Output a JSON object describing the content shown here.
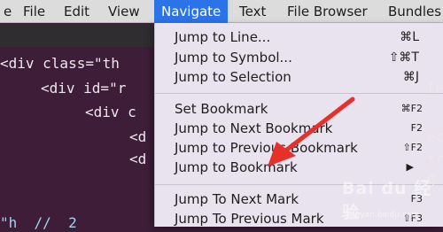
{
  "menubar": {
    "items": [
      "e",
      "File",
      "Edit",
      "View",
      "Navigate",
      "Text",
      "File Browser",
      "Bundles"
    ],
    "active": "Navigate"
  },
  "editor": {
    "lines": [
      "<div class=\"th",
      "<div id=\"r",
      "<div c",
      "<d",
      "<d"
    ],
    "right_fragments": [
      "le",
      "ec",
      "tr",
      "g-"
    ],
    "bottom_fragment": "\"h  //  2"
  },
  "navigate_menu": {
    "items": [
      {
        "label": "Jump to Line...",
        "shortcut": "⌘L"
      },
      {
        "label": "Jump to Symbol...",
        "shortcut": "⇧⌘T"
      },
      {
        "label": "Jump to Selection",
        "shortcut": "⌘J"
      },
      {
        "label": "Set Bookmark",
        "shortcut": "⌘F2"
      },
      {
        "label": "Jump to Next Bookmark",
        "shortcut": "F2"
      },
      {
        "label": "Jump to Previous Bookmark",
        "shortcut": "⇧F2"
      },
      {
        "label": "Jump to Bookmark",
        "shortcut": "▶"
      },
      {
        "label": "Jump To Next Mark",
        "shortcut": "F3"
      },
      {
        "label": "Jump To Previous Mark",
        "shortcut": "⇧F3"
      }
    ]
  },
  "watermark": {
    "logo": "Bai du 经验",
    "url": "jingyan.baidu.com"
  },
  "colors": {
    "accent": "#2b73e8",
    "arrow": "#e8302a",
    "editor_bg": "#3d1d38",
    "menu_bg": "#e8e3ee"
  }
}
